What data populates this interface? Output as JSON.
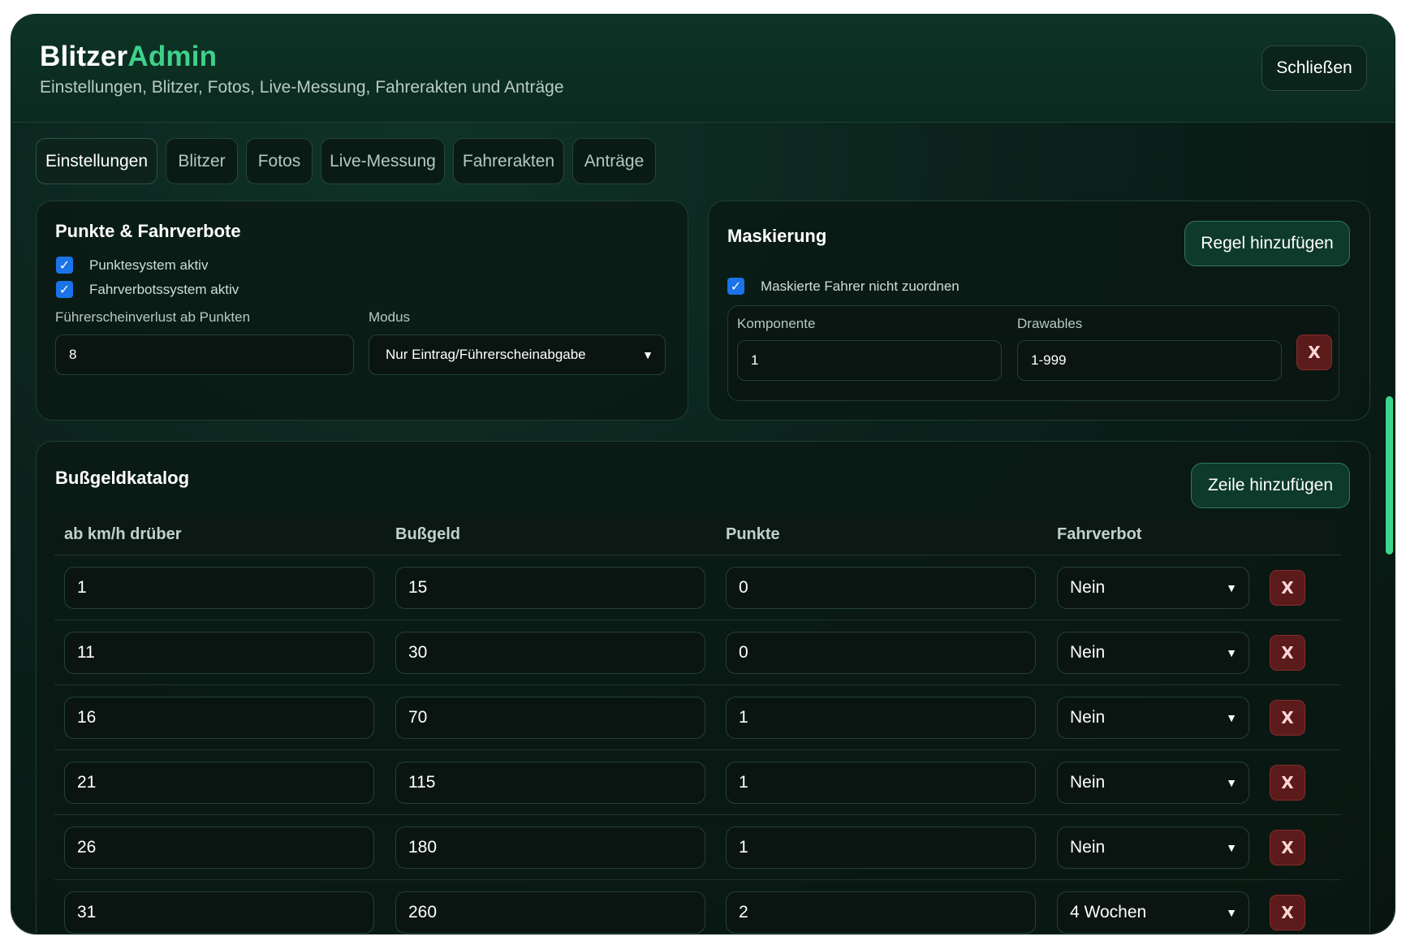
{
  "header": {
    "brand_part1": "Blitzer",
    "brand_part2": "Admin",
    "subtitle": "Einstellungen, Blitzer, Fotos, Live-Messung, Fahrerakten und Anträge",
    "close_label": "Schließen"
  },
  "tabs": [
    {
      "label": "Einstellungen",
      "active": true
    },
    {
      "label": "Blitzer",
      "active": false
    },
    {
      "label": "Fotos",
      "active": false
    },
    {
      "label": "Live-Messung",
      "active": false
    },
    {
      "label": "Fahrerakten",
      "active": false
    },
    {
      "label": "Anträge",
      "active": false
    }
  ],
  "points": {
    "title": "Punkte & Fahrverbote",
    "checkbox1_label": "Punktesystem aktiv",
    "checkbox2_label": "Fahrverbotssystem aktiv",
    "threshold_label": "Führerscheinverlust ab Punkten",
    "threshold_value": "8",
    "mode_label": "Modus",
    "mode_value": "Nur Eintrag/Führerscheinabgabe"
  },
  "masking": {
    "title": "Maskierung",
    "add_rule_label": "Regel hinzufügen",
    "checkbox_label": "Maskierte Fahrer nicht zuordnen",
    "component_label": "Komponente",
    "component_value": "1",
    "drawables_label": "Drawables",
    "drawables_value": "1-999",
    "delete_label": "X"
  },
  "catalog": {
    "title": "Bußgeldkatalog",
    "add_row_label": "Zeile hinzufügen",
    "columns": [
      "ab km/h drüber",
      "Bußgeld",
      "Punkte",
      "Fahrverbot"
    ],
    "delete_label": "X",
    "rows": [
      {
        "kmh": "1",
        "fine": "15",
        "points": "0",
        "ban": "Nein"
      },
      {
        "kmh": "11",
        "fine": "30",
        "points": "0",
        "ban": "Nein"
      },
      {
        "kmh": "16",
        "fine": "70",
        "points": "1",
        "ban": "Nein"
      },
      {
        "kmh": "21",
        "fine": "115",
        "points": "1",
        "ban": "Nein"
      },
      {
        "kmh": "26",
        "fine": "180",
        "points": "1",
        "ban": "Nein"
      },
      {
        "kmh": "31",
        "fine": "260",
        "points": "2",
        "ban": "4 Wochen"
      }
    ]
  },
  "colors": {
    "accent": "#3fd18b",
    "background": "#0b211b",
    "danger": "#5b1b1b",
    "checkbox": "#1a73e8"
  }
}
